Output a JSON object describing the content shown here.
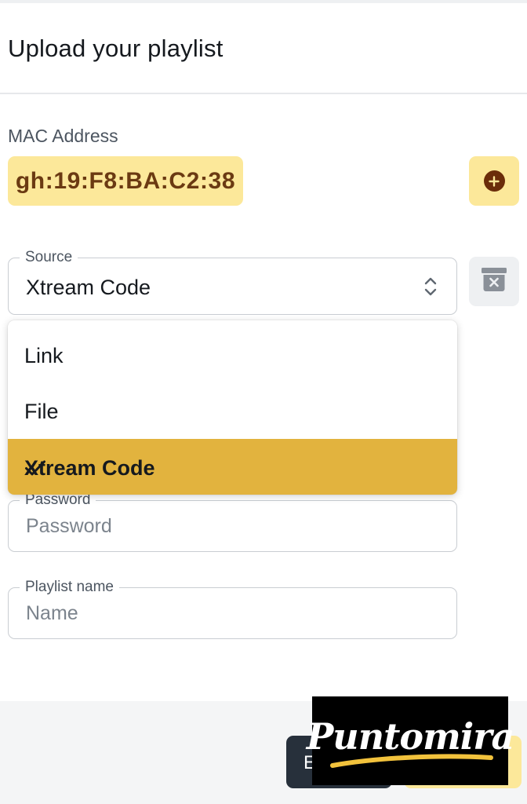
{
  "header": {
    "title": "Upload your playlist"
  },
  "mac": {
    "label": "MAC Address",
    "value": "gh:19:F8:BA:C2:38"
  },
  "source": {
    "label": "Source",
    "value": "Xtream Code",
    "options": [
      "Link",
      "File",
      "Xtream Code"
    ]
  },
  "password": {
    "label": "Password",
    "placeholder": "Password"
  },
  "playlist_name": {
    "label": "Playlist name",
    "placeholder": "Name"
  },
  "footer": {
    "dark_button_label": "E"
  },
  "watermark": {
    "text": "Puntomira"
  },
  "colors": {
    "accent_light": "#fce89a",
    "accent_selected": "#e2b33e",
    "mac_text": "#6b3a12",
    "dark_button": "#27303b"
  },
  "icons": {
    "add": "plus-circle-icon",
    "delete": "archive-x-icon",
    "select": "chevron-up-down-icon",
    "selected": "checkmark-icon"
  }
}
